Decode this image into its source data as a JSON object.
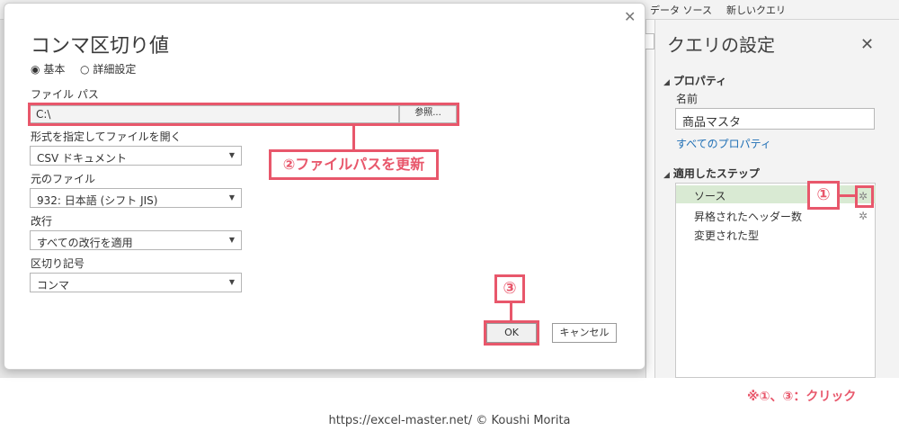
{
  "ribbon": {
    "tabs": [
      "データ ソース",
      "新しいクエリ"
    ]
  },
  "dialog": {
    "title": "コンマ区切り値",
    "modes": [
      {
        "label": "基本",
        "selected": true
      },
      {
        "label": "詳細設定",
        "selected": false
      }
    ],
    "file_path_label": "ファイル パス",
    "file_path_value": "C:\\",
    "browse_label": "参照...",
    "format_label": "形式を指定してファイルを開く",
    "format_value": "CSV ドキュメント",
    "origin_label": "元のファイル",
    "origin_value": "932: 日本語 (シフト JIS)",
    "linebreak_label": "改行",
    "linebreak_value": "すべての改行を適用",
    "delimiter_label": "区切り記号",
    "delimiter_value": "コンマ",
    "ok_label": "OK",
    "cancel_label": "キャンセル"
  },
  "query_settings": {
    "title": "クエリの設定",
    "properties_header": "プロパティ",
    "name_label": "名前",
    "name_value": "商品マスタ",
    "all_properties_link": "すべてのプロパティ",
    "steps_header": "適用したステップ",
    "steps": [
      "ソース",
      "昇格されたヘッダー数",
      "変更された型"
    ]
  },
  "annotations": {
    "mark1": "①",
    "mark2_text": "②ファイルパスを更新",
    "mark3": "③",
    "footnote": "※①、③：クリック",
    "color": "#e8576b"
  },
  "credit": "https://excel-master.net/  © Koushi Morita"
}
